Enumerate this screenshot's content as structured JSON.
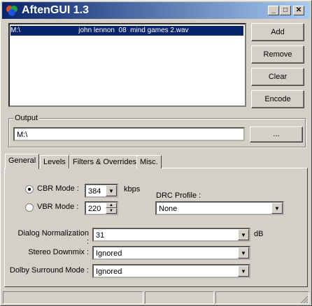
{
  "window": {
    "title": "AftenGUI 1.3",
    "min": "_",
    "max": "□",
    "close": "✕"
  },
  "file_list": {
    "items": [
      "M:\\                              john lennon  08  mind games 2.wav"
    ]
  },
  "buttons": {
    "add": "Add",
    "remove": "Remove",
    "clear": "Clear",
    "encode": "Encode"
  },
  "output": {
    "label": "Output",
    "path": "M:\\",
    "browse": "..."
  },
  "tabs": [
    "General",
    "Levels",
    "Filters & Overrides",
    "Misc."
  ],
  "general": {
    "cbr_label": "CBR Mode :",
    "cbr_value": "384",
    "kbps": "kbps",
    "vbr_label": "VBR Mode :",
    "vbr_value": "220",
    "drc_label": "DRC Profile :",
    "drc_value": "None",
    "dialog_label": "Dialog Normalization :",
    "dialog_value": "31",
    "db": "dB",
    "stereo_label": "Stereo Downmix :",
    "stereo_value": "Ignored",
    "dolby_label": "Dolby Surround Mode :",
    "dolby_value": "Ignored"
  },
  "colors": {
    "face": "#d4d0c8",
    "title_start": "#0a246a",
    "title_end": "#a6caf0",
    "selection": "#0a246a"
  }
}
